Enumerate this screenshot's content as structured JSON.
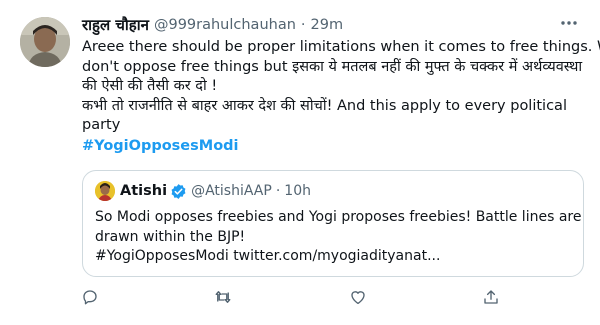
{
  "tweet": {
    "author": {
      "name": "राहुल चौहान",
      "handle": "@999rahulchauhan",
      "separator": "·",
      "time": "29m"
    },
    "body_lines": [
      "Areee there should be proper limitations when it comes to free things. We",
      "don't oppose free things but इसका ये मतलब नहीं की मुफ्त के चक्कर में अर्थव्यवस्था",
      "की ऐसी की तैसी कर दो !",
      "कभी तो राजनीति से बाहर आकर देश की सोचों! And this apply to every political",
      "party"
    ],
    "hashtag": "#YogiOpposesModi",
    "quoted": {
      "name": "Atishi",
      "handle": "@AtishiAAP",
      "separator": "·",
      "time": "10h",
      "body_lines": [
        "So Modi opposes freebies and Yogi proposes freebies! Battle lines are",
        "drawn within the BJP!",
        "#YogiOpposesModi twitter.com/myogiadityanat..."
      ]
    },
    "icons": {
      "more": "more-dots-icon",
      "verified": "verified-badge-icon",
      "reply": "reply-icon",
      "retweet": "retweet-icon",
      "like": "like-icon",
      "share": "share-icon"
    },
    "colors": {
      "text": "#0f1419",
      "secondary": "#536471",
      "accent": "#1d9bf0",
      "border": "#cfd9de"
    }
  }
}
